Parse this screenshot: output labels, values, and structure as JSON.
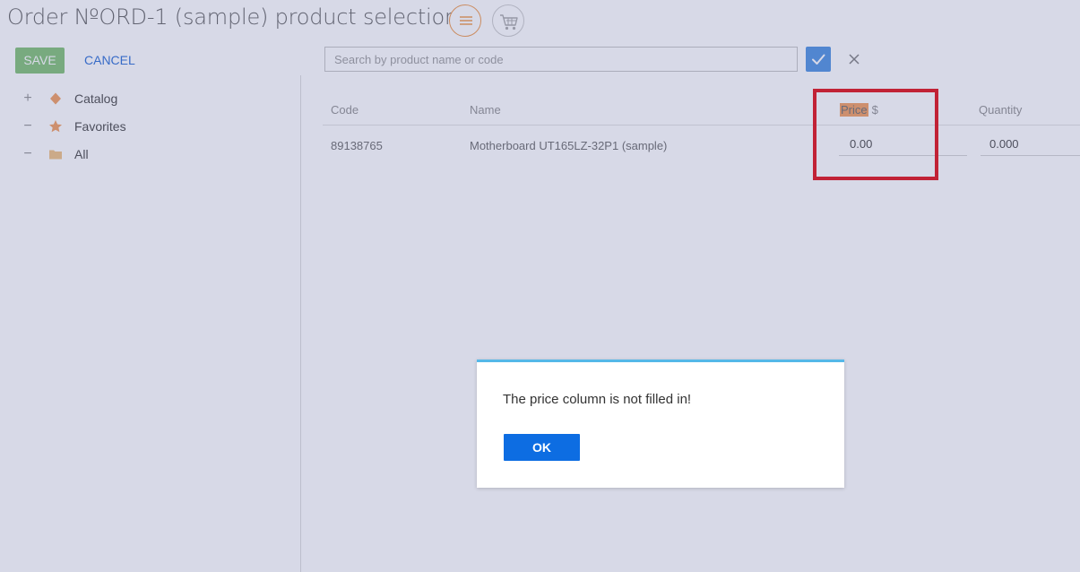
{
  "page": {
    "title": "Order №ORD-1 (sample) product selection"
  },
  "toolbar": {
    "save_label": "SAVE",
    "cancel_label": "CANCEL",
    "menu_icon": "menu-icon",
    "cart_icon": "cart-icon"
  },
  "search": {
    "value": "",
    "placeholder": "Search by product name or code",
    "apply_icon": "checkmark-icon",
    "clear_icon": "close-icon"
  },
  "sidebar": {
    "items": [
      {
        "toggle": "+",
        "icon": "diamond-icon",
        "label": "Catalog"
      },
      {
        "toggle": "−",
        "icon": "star-icon",
        "label": "Favorites"
      },
      {
        "toggle": "−",
        "icon": "folder-icon",
        "label": "All"
      }
    ]
  },
  "grid": {
    "columns": {
      "code": "Code",
      "name": "Name",
      "price": "Price",
      "price_currency": "$",
      "quantity": "Quantity"
    },
    "rows": [
      {
        "code": "89138765",
        "name": "Motherboard UT165LZ-32P1 (sample)",
        "price": "0.00",
        "quantity": "0.000"
      }
    ]
  },
  "dialog": {
    "message": "The price column is not filled in!",
    "ok_label": "OK"
  },
  "colors": {
    "accent": "#0d6de2",
    "save_green": "#8bc57f",
    "highlight_red": "#e41e25",
    "price_highlight": "#f3a46a",
    "dialog_top_border": "#55b8e8"
  }
}
